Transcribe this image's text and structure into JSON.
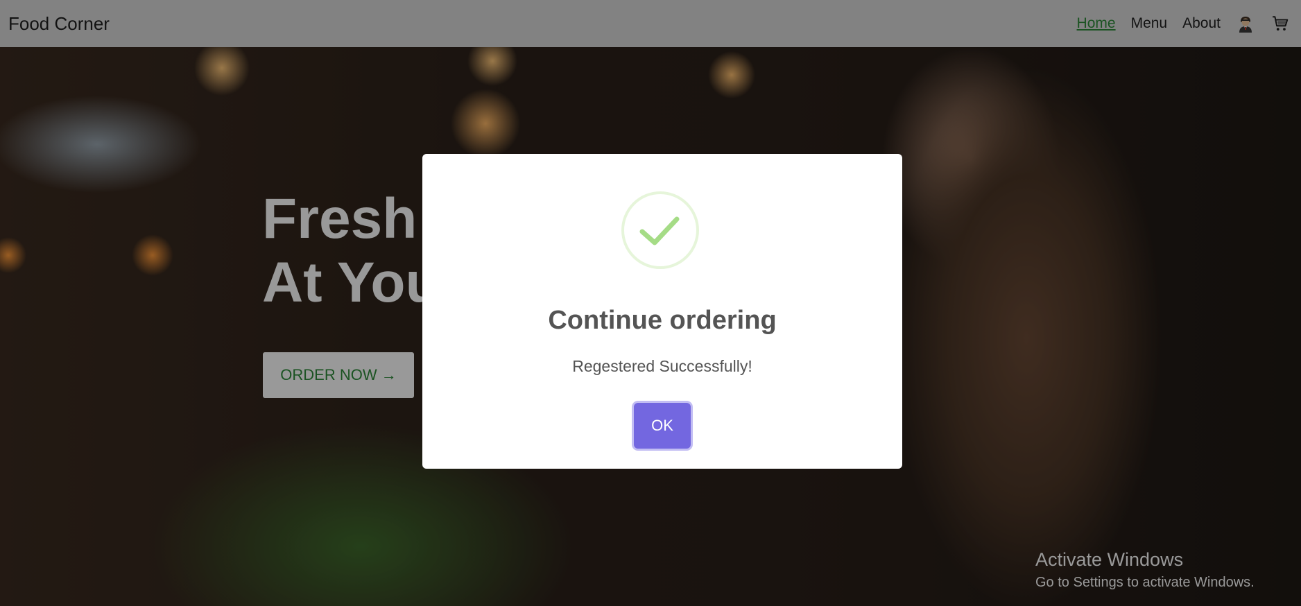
{
  "navbar": {
    "brand": "Food Corner",
    "links": [
      {
        "label": "Home",
        "active": true
      },
      {
        "label": "Menu",
        "active": false
      },
      {
        "label": "About",
        "active": false
      }
    ],
    "icons": [
      "user-avatar-icon",
      "cart-icon"
    ]
  },
  "hero": {
    "title": "Fresh Food\nAt Your Door",
    "order_button": "ORDER NOW →"
  },
  "modal": {
    "icon": "success-check-icon",
    "title": "Continue ordering",
    "text": "Regestered Successfully!",
    "ok_label": "OK"
  },
  "watermark": {
    "title": "Activate Windows",
    "subtitle": "Go to Settings to activate Windows."
  },
  "colors": {
    "accent_green": "#2e8b3a",
    "ok_button": "#7367e0",
    "success_check": "#a5dc86"
  }
}
